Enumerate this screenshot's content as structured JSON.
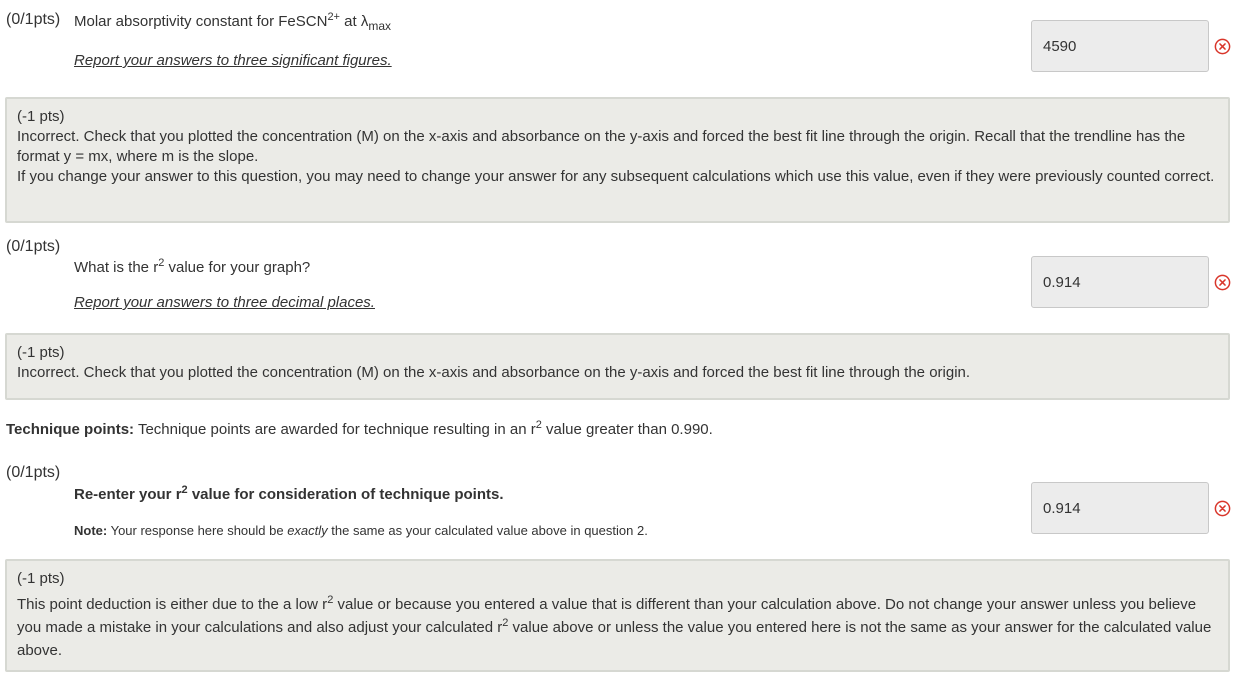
{
  "q1": {
    "points": "(0/1pts)",
    "text_before": "Molar absorptivity constant for FeSCN",
    "text_sup": "2+",
    "text_mid": " at λ",
    "text_sub": "max",
    "instruction": "Report your answers to three significant figures.",
    "answer": "4590"
  },
  "fb1": {
    "points": "(-1 pts)",
    "line1": "Incorrect. Check that you plotted the concentration (M) on the x-axis and absorbance on the y-axis and forced the best fit line through the origin. Recall that the trendline has the format y = mx, where m is the slope.",
    "line2": "If you change your answer to this question, you may need to change your answer for any subsequent calculations which use this value, even if they were previously counted correct."
  },
  "q2": {
    "points": "(0/1pts)",
    "text_before": "What is the r",
    "text_sup": "2",
    "text_after": " value for your graph?",
    "instruction": "Report your answers to three decimal places.",
    "answer": "0.914"
  },
  "fb2": {
    "points": "(-1 pts)",
    "line1": "Incorrect. Check that you plotted the concentration (M) on the x-axis and absorbance on the y-axis and forced the best fit line through the origin."
  },
  "technique": {
    "label": "Technique points:",
    "text_before": " Technique points are awarded for technique resulting in an r",
    "text_sup": "2",
    "text_after": " value greater than 0.990."
  },
  "q3": {
    "points": "(0/1pts)",
    "text_before": "Re-enter your r",
    "text_sup": "2",
    "text_after": " value for consideration of technique points.",
    "note_label": "Note:",
    "note_before": " Your response here should be ",
    "note_italic": "exactly",
    "note_after": " the same as your calculated value above in question 2.",
    "answer": "0.914"
  },
  "fb3": {
    "points": "(-1 pts)",
    "part1": "This point deduction is either due to the a low r",
    "sup1": "2",
    "part2": " value or because you entered a value that is different than your calculation above. Do not change your answer unless you believe you made a mistake in your calculations and also adjust your calculated r",
    "sup2": "2",
    "part3": " value above or unless the value you entered here is not the same as your answer for the calculated value above."
  },
  "icons": {
    "incorrect": "x-circle-icon",
    "incorrect_color": "#d9362b"
  }
}
